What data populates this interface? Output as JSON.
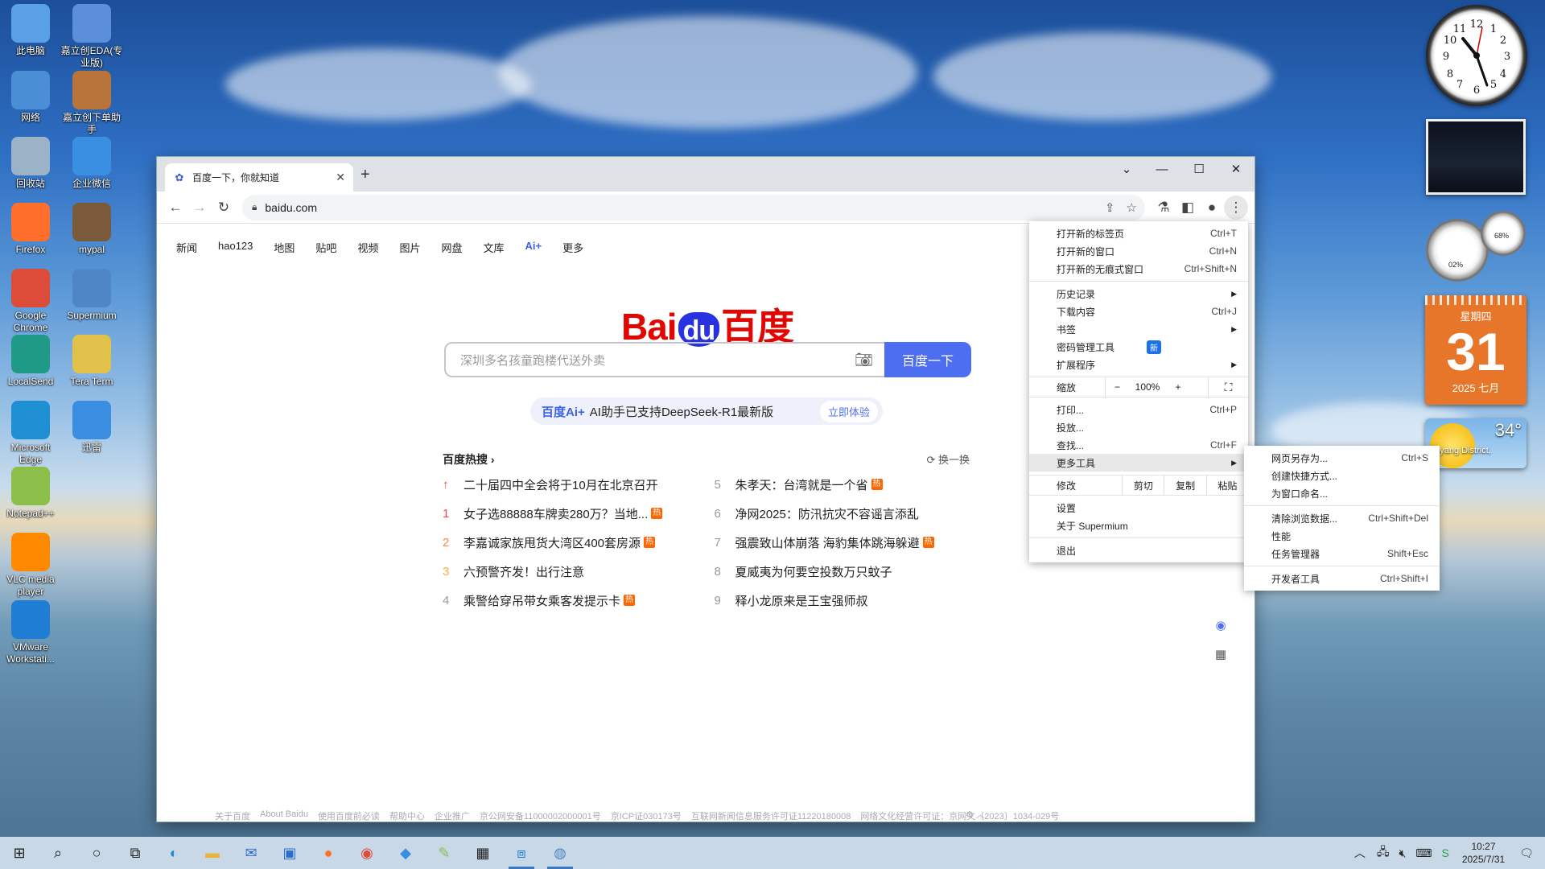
{
  "desktop": {
    "icons": [
      {
        "label": "此电脑",
        "icon": "computer-icon",
        "color": "#5aa0e6"
      },
      {
        "label": "嘉立创EDA(专业版)",
        "icon": "eda-pro-icon",
        "color": "#5b8fd9"
      },
      {
        "label": "网络",
        "icon": "network-icon",
        "color": "#4a8fd6"
      },
      {
        "label": "嘉立创下单助手",
        "icon": "order-helper-icon",
        "color": "#b8743a"
      },
      {
        "label": "回收站",
        "icon": "recycle-bin-icon",
        "color": "#9bb3c7"
      },
      {
        "label": "企业微信",
        "icon": "wecom-icon",
        "color": "#3b8fe0"
      },
      {
        "label": "Firefox",
        "icon": "firefox-icon",
        "color": "#ff6f2b"
      },
      {
        "label": "mypal",
        "icon": "mypal-icon",
        "color": "#7a5a3a"
      },
      {
        "label": "Google Chrome",
        "icon": "chrome-icon",
        "color": "#dd4b39"
      },
      {
        "label": "Supermium",
        "icon": "supermium-icon",
        "color": "#4f86c6"
      },
      {
        "label": "LocalSend",
        "icon": "localsend-icon",
        "color": "#1f9a86"
      },
      {
        "label": "Tera Term",
        "icon": "teraterm-icon",
        "color": "#e0c24a"
      },
      {
        "label": "Microsoft Edge",
        "icon": "edge-icon",
        "color": "#1f8fd3"
      },
      {
        "label": "迅雷",
        "icon": "thunder-icon",
        "color": "#3a8de0"
      },
      {
        "label": "Notepad++",
        "icon": "notepadpp-icon",
        "color": "#8bbf4a"
      },
      {
        "label": "VLC media player",
        "icon": "vlc-icon",
        "color": "#ff8a00"
      },
      {
        "label": "VMware Workstati...",
        "icon": "vmware-icon",
        "color": "#1f7ed4"
      }
    ]
  },
  "browser": {
    "tab_title": "百度一下，你就知道",
    "url": "baidu.com"
  },
  "baidu": {
    "nav": [
      "新闻",
      "hao123",
      "地图",
      "贴吧",
      "视频",
      "图片",
      "网盘",
      "文库",
      "Ai+",
      "更多"
    ],
    "logo_text": "Bai",
    "logo_du": "du",
    "logo_cn": "百度",
    "search_placeholder": "深圳多名孩童跑楼代送外卖",
    "search_button": "百度一下",
    "ai_brand": "百度Ai+",
    "ai_text": "AI助手已支持DeepSeek-R1最新版",
    "ai_try": "立即体验",
    "hot_title": "百度热搜",
    "hot_refresh": "换一换",
    "hot_items": [
      {
        "n": "↑",
        "t": "二十届四中全会将于10月在北京召开",
        "tag": "",
        "nc": "#f54545"
      },
      {
        "n": "5",
        "t": "朱孝天：台湾就是一个省",
        "tag": "热",
        "nc": "#999"
      },
      {
        "n": "1",
        "t": "女子选88888车牌卖280万？当地...",
        "tag": "热",
        "nc": "#f54545"
      },
      {
        "n": "6",
        "t": "净网2025：防汛抗灾不容谣言添乱",
        "tag": "",
        "nc": "#999"
      },
      {
        "n": "2",
        "t": "李嘉诚家族甩货大湾区400套房源",
        "tag": "热",
        "nc": "#ff8547"
      },
      {
        "n": "7",
        "t": "强震致山体崩落 海豹集体跳海躲避",
        "tag": "热",
        "nc": "#999"
      },
      {
        "n": "3",
        "t": "六预警齐发！出行注意",
        "tag": "",
        "nc": "#ffac38"
      },
      {
        "n": "8",
        "t": "夏威夷为何要空投数万只蚊子",
        "tag": "",
        "nc": "#999"
      },
      {
        "n": "4",
        "t": "乘警给穿吊带女乘客发提示卡",
        "tag": "热",
        "nc": "#999"
      },
      {
        "n": "9",
        "t": "释小龙原来是王宝强师叔",
        "tag": "",
        "nc": "#999"
      }
    ],
    "footer": [
      "关于百度",
      "About Baidu",
      "使用百度前必读",
      "帮助中心",
      "企业推广",
      "京公网安备11000002000001号",
      "京ICP证030173号",
      "互联网新闻信息服务许可证11220180008",
      "网络文化经营许可证：京网文〔2023〕1034-029号"
    ]
  },
  "main_menu": {
    "items1": [
      {
        "label": "打开新的标签页",
        "sc": "Ctrl+T"
      },
      {
        "label": "打开新的窗口",
        "sc": "Ctrl+N"
      },
      {
        "label": "打开新的无痕式窗口",
        "sc": "Ctrl+Shift+N"
      }
    ],
    "history": "历史记录",
    "downloads": "下载内容",
    "downloads_sc": "Ctrl+J",
    "bookmarks": "书签",
    "password": "密码管理工具",
    "password_badge": "新",
    "extensions": "扩展程序",
    "zoom_label": "缩放",
    "zoom_minus": "−",
    "zoom_value": "100%",
    "zoom_plus": "+",
    "print": "打印...",
    "print_sc": "Ctrl+P",
    "cast": "投放...",
    "find": "查找...",
    "find_sc": "Ctrl+F",
    "more_tools": "更多工具",
    "edit_label": "修改",
    "cut": "剪切",
    "copy": "复制",
    "paste": "粘贴",
    "settings": "设置",
    "about": "关于 Supermium",
    "exit": "退出"
  },
  "sub_menu": {
    "save_page": "网页另存为...",
    "save_page_sc": "Ctrl+S",
    "create_shortcut": "创建快捷方式...",
    "name_window": "为窗口命名...",
    "clear_data": "清除浏览数据...",
    "clear_data_sc": "Ctrl+Shift+Del",
    "performance": "性能",
    "task_manager": "任务管理器",
    "task_manager_sc": "Shift+Esc",
    "devtools": "开发者工具",
    "devtools_sc": "Ctrl+Shift+I"
  },
  "gadgets": {
    "calendar_weekday": "星期四",
    "calendar_day": "31",
    "calendar_month": "2025 七月",
    "weather_temp": "34°",
    "weather_loc": "ngyang District,",
    "meter_left": "02%",
    "meter_right": "68%"
  },
  "taskbar": {
    "time": "10:27",
    "date": "2025/7/31"
  }
}
